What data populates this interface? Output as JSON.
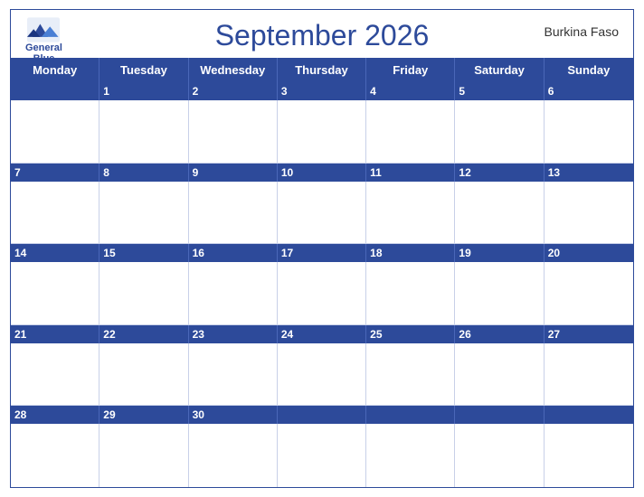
{
  "header": {
    "logo_general": "General",
    "logo_blue": "Blue",
    "month_year": "September 2026",
    "country": "Burkina Faso"
  },
  "weekdays": [
    "Monday",
    "Tuesday",
    "Wednesday",
    "Thursday",
    "Friday",
    "Saturday",
    "Sunday"
  ],
  "weeks": [
    {
      "days": [
        "",
        "1",
        "2",
        "3",
        "4",
        "5",
        "6"
      ]
    },
    {
      "days": [
        "7",
        "8",
        "9",
        "10",
        "11",
        "12",
        "13"
      ]
    },
    {
      "days": [
        "14",
        "15",
        "16",
        "17",
        "18",
        "19",
        "20"
      ]
    },
    {
      "days": [
        "21",
        "22",
        "23",
        "24",
        "25",
        "26",
        "27"
      ]
    },
    {
      "days": [
        "28",
        "29",
        "30",
        "",
        "",
        "",
        ""
      ]
    }
  ]
}
